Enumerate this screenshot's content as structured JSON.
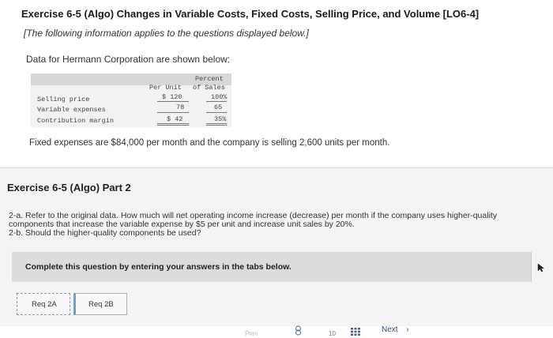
{
  "exercise": {
    "title": "Exercise 6-5 (Algo) Changes in Variable Costs, Fixed Costs, Selling Price, and Volume [LO6-4]",
    "subtitle": "[The following information applies to the questions displayed below.]",
    "data_intro": "Data for Hermann Corporation are shown below:"
  },
  "data_table": {
    "header_top": "Percent",
    "col_per_unit": "Per Unit",
    "col_of_sales": "of Sales",
    "rows": [
      {
        "label": "Selling price",
        "per_unit": "$ 120",
        "percent": "100%"
      },
      {
        "label": "Variable expenses",
        "per_unit": "78",
        "percent": "65"
      },
      {
        "label": "Contribution margin",
        "per_unit": "$ 42",
        "percent": "35%"
      }
    ]
  },
  "fixed_note": "Fixed expenses are $84,000 per month and the company is selling 2,600 units per month.",
  "part": {
    "title": "Exercise 6-5 (Algo) Part 2",
    "question_lines": [
      "2-a. Refer to the original data. How much will net operating income increase (decrease) per month if the company uses higher-quality",
      "components that increase the variable expense by $5 per unit and increase unit sales by 20%.",
      "2-b. Should the higher-quality components be used?"
    ],
    "instruction": "Complete this question by entering your answers in the tabs below."
  },
  "tabs": [
    {
      "label": "Req 2A"
    },
    {
      "label": "Req 2B"
    }
  ],
  "footer": {
    "prev_fragment": "Prev",
    "page_fragment": "10",
    "next_label": "Next",
    "next_arrow": "›",
    "link_icon": "link-icon",
    "grid_icon": "grid-icon"
  },
  "colors": {
    "accent_link": "#2a4f8a",
    "table_bg": "#f2f2f2",
    "instruction_bg": "#dcdcdc"
  }
}
